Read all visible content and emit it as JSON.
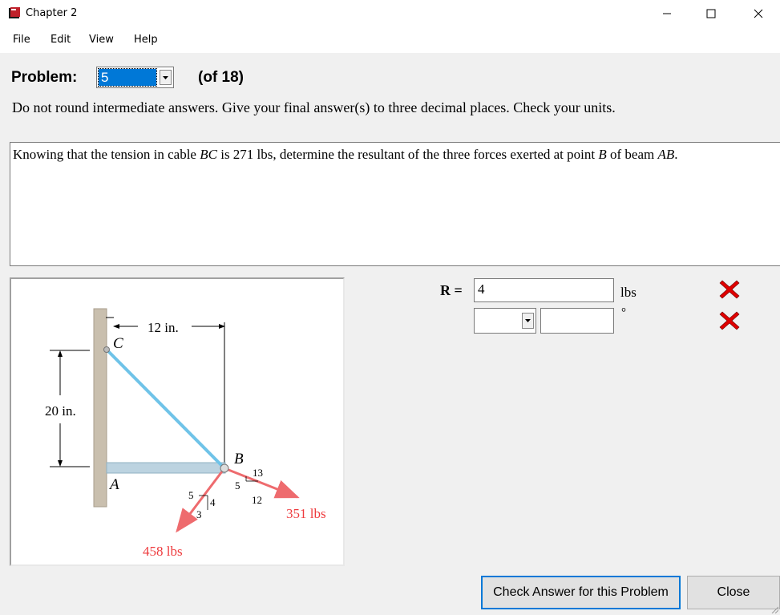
{
  "window": {
    "title": "Chapter 2",
    "icon": "book-icon",
    "controls": [
      "minimize-icon",
      "maximize-icon",
      "close-icon"
    ]
  },
  "menu": {
    "items": [
      "File",
      "Edit",
      "View",
      "Help"
    ]
  },
  "problem": {
    "label": "Problem:",
    "selected": "5",
    "of_text": "(of 18)"
  },
  "instructions": "Do not round intermediate answers.  Give your final answer(s) to three decimal places.  Check your units.",
  "question": {
    "t1": "Knowing that the tension in cable ",
    "bc": "BC",
    "t2": " is 271 lbs, determine the resultant of the three forces exerted at point ",
    "b": "B",
    "t3": " of beam ",
    "ab": "AB",
    "t4": "."
  },
  "figure": {
    "dim_horizontal": "12 in.",
    "dim_vertical": "20 in.",
    "label_c": "C",
    "label_b": "B",
    "label_a": "A",
    "slope1": {
      "h": "13",
      "a": "5",
      "b": "12"
    },
    "slope2": {
      "h": "5",
      "a": "4",
      "b": "3"
    },
    "force1": "351 lbs",
    "force2": "458 lbs",
    "colors": {
      "cable": "#6fc3e8",
      "force": "#ee6b6e",
      "wall": "#c9bfae",
      "beam": "#bcd3e0"
    }
  },
  "answer": {
    "r_label": "R =",
    "r_value": "4",
    "unit_magnitude": "lbs",
    "unit_angle": "°",
    "direction_value": "",
    "angle_value": "",
    "status_icons": [
      "incorrect-icon",
      "incorrect-icon"
    ],
    "status_color": "#e00000"
  },
  "buttons": {
    "check": "Check Answer for this Problem",
    "close": "Close"
  }
}
